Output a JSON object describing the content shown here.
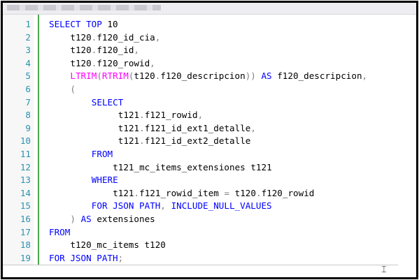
{
  "editor": {
    "language": "sql",
    "lines": [
      {
        "number": "1",
        "indent": 0,
        "tokens": [
          [
            "kw",
            "SELECT TOP"
          ],
          [
            "id",
            " 10"
          ]
        ]
      },
      {
        "number": "2",
        "indent": 4,
        "tokens": [
          [
            "id",
            "t120"
          ],
          [
            "op",
            "."
          ],
          [
            "id",
            "f120_id_cia"
          ],
          [
            "op",
            ","
          ]
        ]
      },
      {
        "number": "3",
        "indent": 4,
        "tokens": [
          [
            "id",
            "t120"
          ],
          [
            "op",
            "."
          ],
          [
            "id",
            "f120_id"
          ],
          [
            "op",
            ","
          ]
        ]
      },
      {
        "number": "4",
        "indent": 4,
        "tokens": [
          [
            "id",
            "t120"
          ],
          [
            "op",
            "."
          ],
          [
            "id",
            "f120_rowid"
          ],
          [
            "op",
            ","
          ]
        ]
      },
      {
        "number": "5",
        "indent": 4,
        "tokens": [
          [
            "fn",
            "LTRIM"
          ],
          [
            "op",
            "("
          ],
          [
            "fn",
            "RTRIM"
          ],
          [
            "op",
            "("
          ],
          [
            "id",
            "t120"
          ],
          [
            "op",
            "."
          ],
          [
            "id",
            "f120_descripcion"
          ],
          [
            "op",
            "))"
          ],
          [
            "id",
            " "
          ],
          [
            "kw",
            "AS"
          ],
          [
            "id",
            " f120_descripcion"
          ],
          [
            "op",
            ","
          ]
        ]
      },
      {
        "number": "6",
        "indent": 4,
        "tokens": [
          [
            "op",
            "("
          ]
        ]
      },
      {
        "number": "7",
        "indent": 8,
        "tokens": [
          [
            "kw",
            "SELECT"
          ]
        ]
      },
      {
        "number": "8",
        "indent": 13,
        "tokens": [
          [
            "id",
            "t121"
          ],
          [
            "op",
            "."
          ],
          [
            "id",
            "f121_rowid"
          ],
          [
            "op",
            ","
          ]
        ]
      },
      {
        "number": "9",
        "indent": 13,
        "tokens": [
          [
            "id",
            "t121"
          ],
          [
            "op",
            "."
          ],
          [
            "id",
            "f121_id_ext1_detalle"
          ],
          [
            "op",
            ","
          ]
        ]
      },
      {
        "number": "10",
        "indent": 13,
        "tokens": [
          [
            "id",
            "t121"
          ],
          [
            "op",
            "."
          ],
          [
            "id",
            "f121_id_ext2_detalle"
          ]
        ]
      },
      {
        "number": "11",
        "indent": 8,
        "tokens": [
          [
            "kw",
            "FROM"
          ]
        ]
      },
      {
        "number": "12",
        "indent": 12,
        "tokens": [
          [
            "id",
            "t121_mc_items_extensiones t121"
          ]
        ]
      },
      {
        "number": "13",
        "indent": 8,
        "tokens": [
          [
            "kw",
            "WHERE"
          ]
        ]
      },
      {
        "number": "14",
        "indent": 12,
        "tokens": [
          [
            "id",
            "t121"
          ],
          [
            "op",
            "."
          ],
          [
            "id",
            "f121_rowid_item "
          ],
          [
            "op",
            "="
          ],
          [
            "id",
            " t120"
          ],
          [
            "op",
            "."
          ],
          [
            "id",
            "f120_rowid"
          ]
        ]
      },
      {
        "number": "15",
        "indent": 8,
        "tokens": [
          [
            "kw",
            "FOR JSON PATH"
          ],
          [
            "op",
            ","
          ],
          [
            "id",
            " "
          ],
          [
            "kw",
            "INCLUDE_NULL_VALUES"
          ]
        ]
      },
      {
        "number": "16",
        "indent": 4,
        "tokens": [
          [
            "op",
            ")"
          ],
          [
            "id",
            " "
          ],
          [
            "kw",
            "AS"
          ],
          [
            "id",
            " extensiones"
          ]
        ]
      },
      {
        "number": "17",
        "indent": 0,
        "tokens": [
          [
            "kw",
            "FROM"
          ]
        ]
      },
      {
        "number": "18",
        "indent": 4,
        "tokens": [
          [
            "id",
            "t120_mc_items t120"
          ]
        ]
      },
      {
        "number": "19",
        "indent": 0,
        "tokens": [
          [
            "kw",
            "FOR JSON PATH"
          ],
          [
            "op",
            ";"
          ]
        ]
      }
    ]
  },
  "colors": {
    "keyword": "#0000ff",
    "function": "#ff00ff",
    "identifier": "#000000",
    "operator": "#808080",
    "line_number": "#2b91af",
    "change_bar": "#4aa84a"
  },
  "icons": {
    "text_cursor": "i-beam-cursor-icon"
  }
}
